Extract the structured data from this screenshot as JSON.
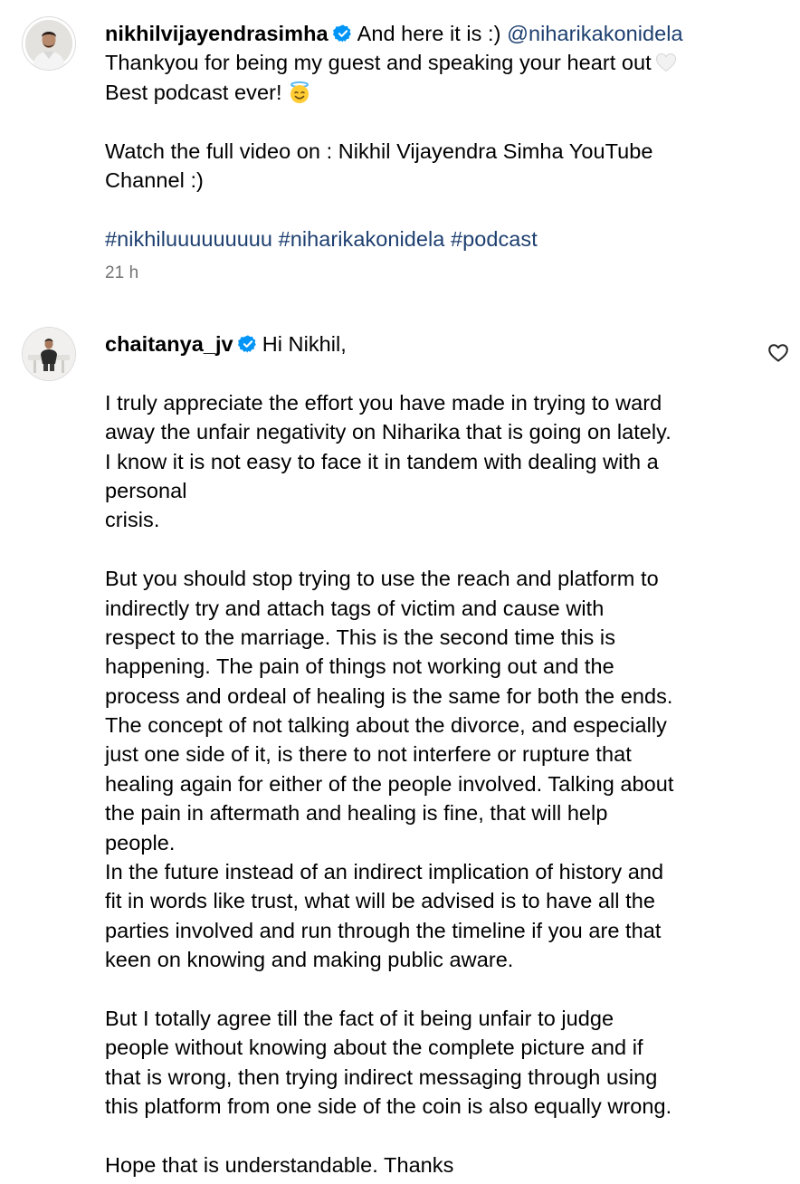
{
  "caption_post": {
    "username": "nikhilvijayendrasimha",
    "avatar_icon": "profile-avatar-icon",
    "verified_icon": "verified-badge-icon",
    "text_first": "And here it is :)",
    "mention": "@niharikakonidela",
    "line2": "Thankyou for being my guest and speaking your heart out",
    "line2_emoji": "white-heart-emoji",
    "line3": "Best podcast ever!",
    "line3_emoji": "smiling-face-with-halo-emoji",
    "line5": "Watch the full video on : Nikhil Vijayendra Simha YouTube",
    "line6": "Channel :)",
    "hashtags": [
      "#nikhiluuuuuuuuu",
      "#niharikakonidela",
      "#podcast"
    ],
    "timestamp": "21 h"
  },
  "comment": {
    "username": "chaitanya_jv",
    "avatar_icon": "profile-avatar-icon",
    "verified_icon": "verified-badge-icon",
    "like_icon": "heart-outline-icon",
    "greeting": "Hi Nikhil,",
    "paragraph1": [
      "I truly appreciate the effort you have made in trying to ward",
      "away the unfair negativity on Niharika that is going on lately.",
      "I know it is not easy to face it in tandem with dealing with a",
      "personal",
      "crisis."
    ],
    "paragraph2": [
      "But you should stop trying to use the reach and platform to",
      "indirectly try and attach tags of victim and cause with",
      "respect to the marriage. This is the second time this is",
      "happening. The pain of things not working out and the",
      "process and ordeal of healing is the same for both the ends.",
      "The concept of not talking about the divorce, and especially",
      "just one side of it, is there to not interfere or rupture that",
      "healing again for either of the people involved. Talking about",
      "the pain in aftermath and healing is fine, that will help",
      "people.",
      "In the future instead of an indirect implication of history and",
      "fit in words like trust, what will be advised is to have all the",
      "parties involved and run through the timeline if you are that",
      "keen on knowing and making public aware."
    ],
    "paragraph3": [
      "But I totally agree till the fact of it being unfair to judge",
      "people without knowing about the complete picture and if",
      "that is wrong, then trying indirect messaging through using",
      "this platform from one side of the coin is also equally wrong."
    ],
    "closing": "Hope that is understandable. Thanks"
  },
  "colors": {
    "text": "#000000",
    "link": "#1d3f70",
    "muted": "#737373",
    "verified": "#0095f6"
  }
}
